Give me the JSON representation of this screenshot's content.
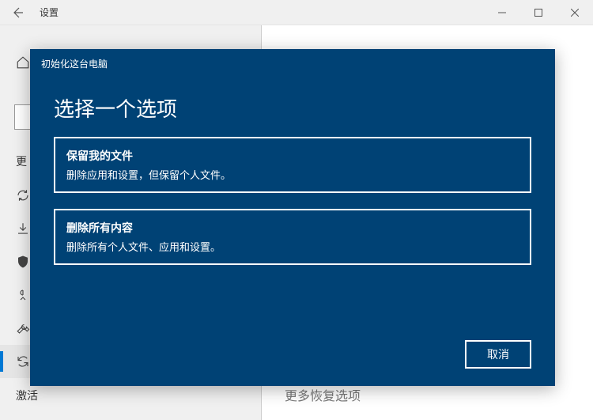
{
  "window": {
    "title": "设置"
  },
  "sidebar": {
    "update_label": "更",
    "activation_label": "激活"
  },
  "main": {
    "behind_text": "更多恢复选项"
  },
  "modal": {
    "header_small": "初始化这台电脑",
    "title": "选择一个选项",
    "options": [
      {
        "title": "保留我的文件",
        "desc": "删除应用和设置，但保留个人文件。"
      },
      {
        "title": "删除所有内容",
        "desc": "删除所有个人文件、应用和设置。"
      }
    ],
    "cancel": "取消"
  }
}
